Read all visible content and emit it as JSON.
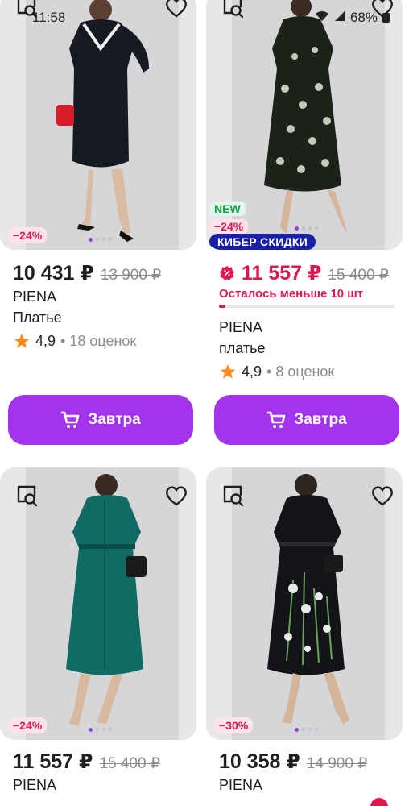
{
  "status": {
    "time": "11:58",
    "battery": "68%"
  },
  "products": [
    {
      "price": "10 431 ₽",
      "old_price": "13 900 ₽",
      "discount": "−24%",
      "brand": "PIENA",
      "type": "Платье",
      "rating": "4,9",
      "reviews": "• 18 оценок",
      "button": "Завтра",
      "dress_color": "#161a22"
    },
    {
      "price": "11 557 ₽",
      "old_price": "15 400 ₽",
      "badge_new": "NEW",
      "discount": "−24%",
      "badge_cyber": "КИБЕР СКИДКИ",
      "stock": "Осталось меньше 10 шт",
      "brand": "PIENA",
      "type": "платье",
      "rating": "4,9",
      "reviews": "• 8 оценок",
      "button": "Завтра",
      "dress_color": "#1b2218"
    },
    {
      "price": "11 557 ₽",
      "old_price": "15 400 ₽",
      "discount": "−24%",
      "brand": "PIENA",
      "dress_color": "#0f6b63"
    },
    {
      "price": "10 358 ₽",
      "old_price": "14 900 ₽",
      "discount": "−30%",
      "brand": "PIENA",
      "dress_color": "#121418"
    }
  ],
  "colors": {
    "accent": "#a433f0",
    "sale": "#e0184e",
    "cyber": "#1a1fa8"
  }
}
